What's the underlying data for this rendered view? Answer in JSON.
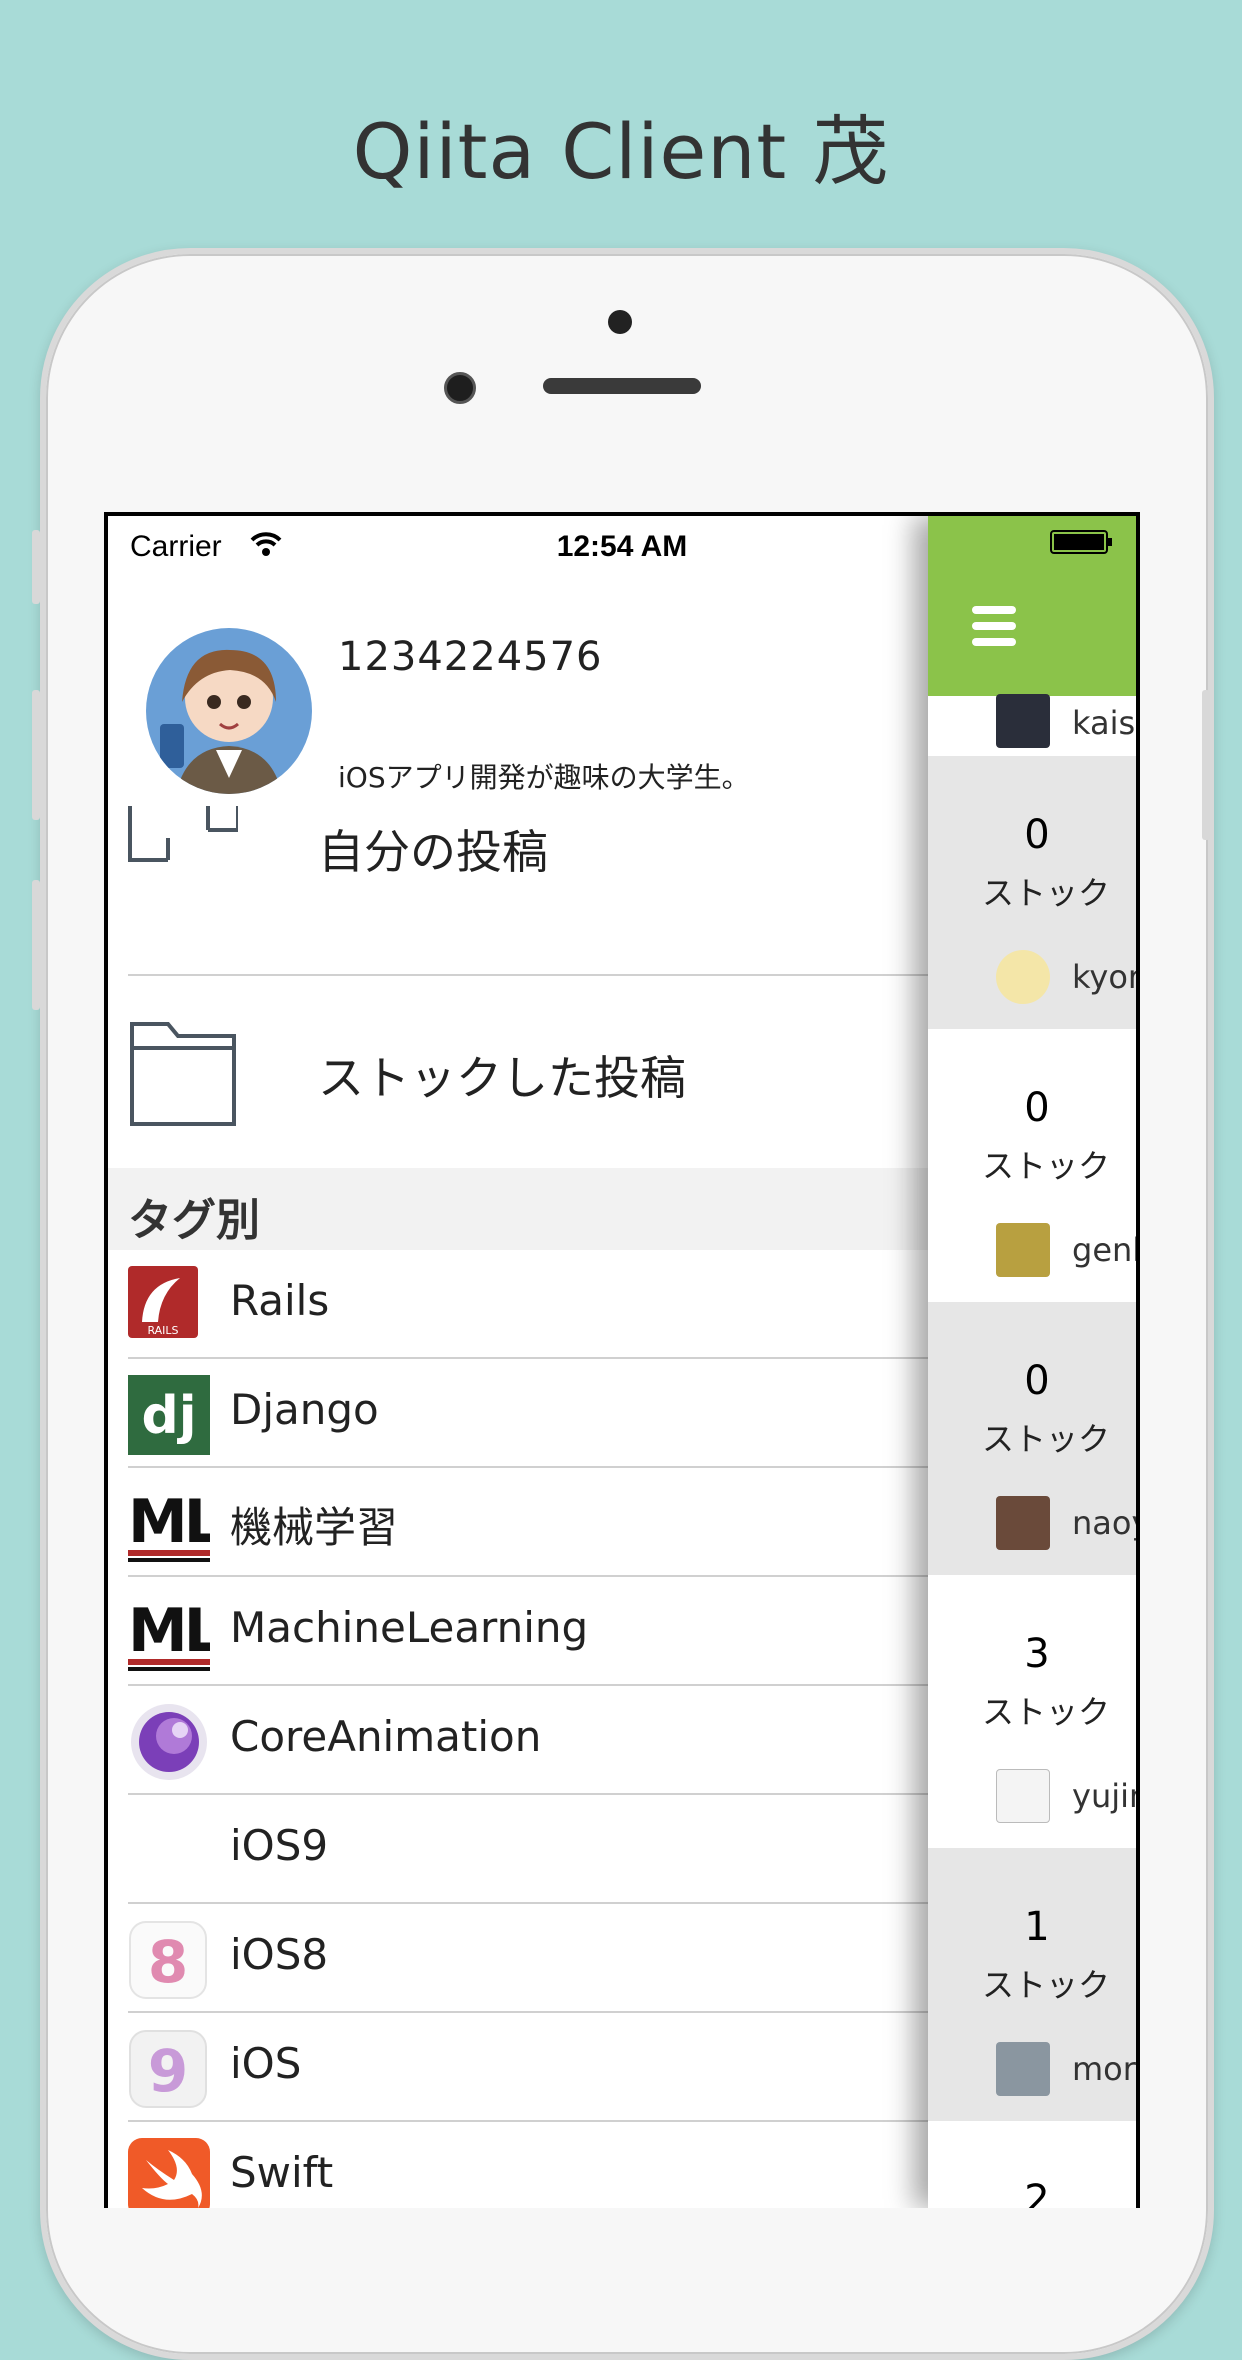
{
  "headline": "Qiita Client 茂",
  "status_bar": {
    "carrier": "Carrier",
    "time": "12:54 AM"
  },
  "profile": {
    "name": "1234224576",
    "bio": "iOSアプリ開発が趣味の大学生。"
  },
  "menu": [
    {
      "label": "自分の投稿",
      "icon": "document-icon"
    },
    {
      "label": "ストックした投稿",
      "icon": "folder-icon"
    }
  ],
  "tags_section": {
    "title": "タグ別"
  },
  "tags": [
    {
      "label": "Rails",
      "icon": "rails-icon"
    },
    {
      "label": "Django",
      "icon": "django-icon"
    },
    {
      "label": "機械学習",
      "icon": "ml-icon"
    },
    {
      "label": "MachineLearning",
      "icon": "ml-icon"
    },
    {
      "label": "CoreAnimation",
      "icon": "coreanimation-icon"
    },
    {
      "label": "iOS9",
      "icon": ""
    },
    {
      "label": "iOS8",
      "icon": "ios8-icon"
    },
    {
      "label": "iOS",
      "icon": "ios9-icon"
    },
    {
      "label": "Swift",
      "icon": "swift-icon"
    }
  ],
  "feed": [
    {
      "user": "kais",
      "count": "0",
      "unit": "ストック"
    },
    {
      "user": "kyor",
      "count": "0",
      "unit": "ストック"
    },
    {
      "user": "genl",
      "count": "0",
      "unit": "ストック"
    },
    {
      "user": "naoy",
      "count": "3",
      "unit": "ストック"
    },
    {
      "user": "yujin",
      "count": "1",
      "unit": "ストック"
    },
    {
      "user": "mor",
      "count": "2",
      "unit": ""
    }
  ],
  "colors": {
    "background": "#a8dbd7",
    "nav_green": "#8bc34a",
    "feed_gray": "#e6e6e6"
  }
}
